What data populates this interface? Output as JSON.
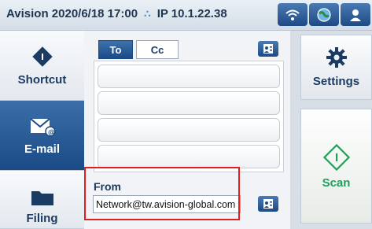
{
  "status": {
    "text": "Avision 2020/6/18 17:00",
    "ip": "IP 10.1.22.38",
    "network_icon": "network-icon"
  },
  "statusbar_buttons": [
    "wifi-icon",
    "globe-icon",
    "user-icon"
  ],
  "sidebar": {
    "items": [
      {
        "label": "Shortcut",
        "icon": "shortcut-diamond-icon"
      },
      {
        "label": "E-mail",
        "icon": "email-icon",
        "active": true
      },
      {
        "label": "Filing",
        "icon": "folder-icon"
      }
    ]
  },
  "tabs": {
    "to": "To",
    "cc": "Cc"
  },
  "recipient_fields": [
    "",
    "",
    "",
    ""
  ],
  "from": {
    "label": "From",
    "value": "Network@tw.avision-global.com"
  },
  "right": {
    "settings": "Settings",
    "scan": "Scan"
  },
  "colors": {
    "accent": "#1b4b86",
    "scan_green": "#1ea05a",
    "highlight": "#e0201e"
  }
}
